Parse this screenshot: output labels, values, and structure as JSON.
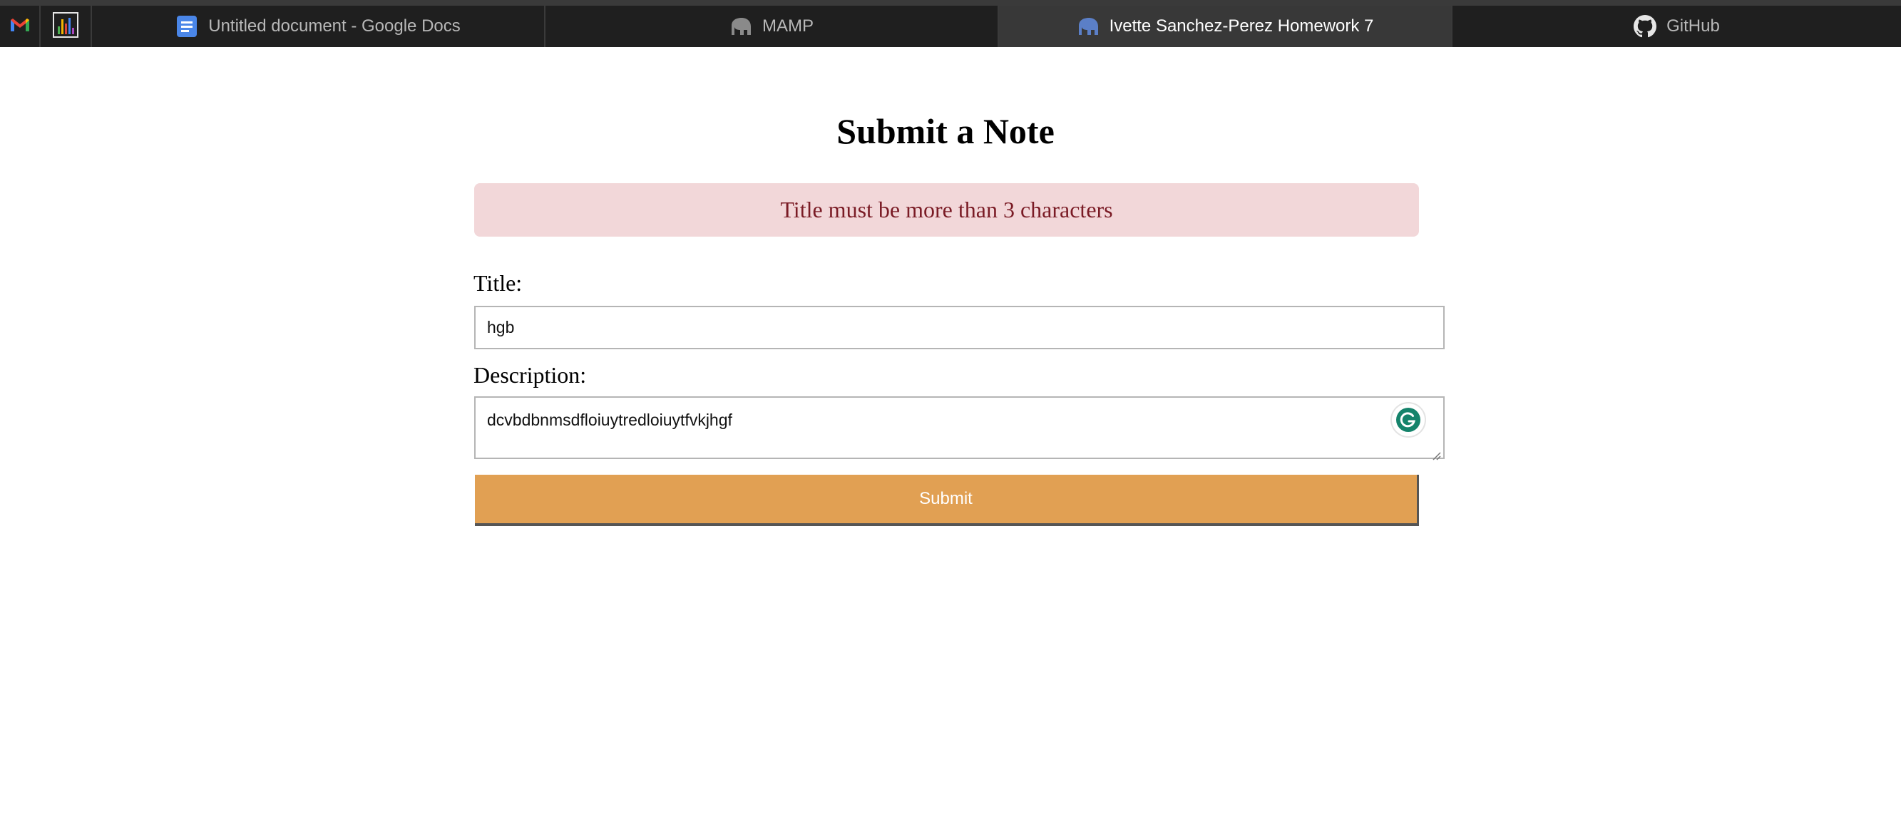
{
  "tabs": [
    {
      "label": "Untitled document - Google Docs",
      "icon": "google-docs-icon",
      "active": false
    },
    {
      "label": "MAMP",
      "icon": "mamp-elephant-icon",
      "active": false
    },
    {
      "label": "Ivette Sanchez-Perez Homework 7",
      "icon": "php-elephant-icon",
      "active": true
    },
    {
      "label": "GitHub",
      "icon": "github-icon",
      "active": false
    }
  ],
  "pinned": [
    {
      "icon": "gmail-icon"
    },
    {
      "icon": "analytics-icon"
    }
  ],
  "page": {
    "heading": "Submit a Note",
    "error_message": "Title must be more than 3 characters",
    "title_label": "Title:",
    "title_value": "hgb",
    "description_label": "Description:",
    "description_value": "dcvbdbnmsdfloiuytredloiuytfvkjhgf",
    "submit_label": "Submit"
  },
  "colors": {
    "alert_bg": "#f2d7d9",
    "alert_text": "#7a1b25",
    "submit_bg": "#e1a053",
    "tabstrip_bg": "#1f1f1f",
    "grammarly": "#15836b"
  }
}
